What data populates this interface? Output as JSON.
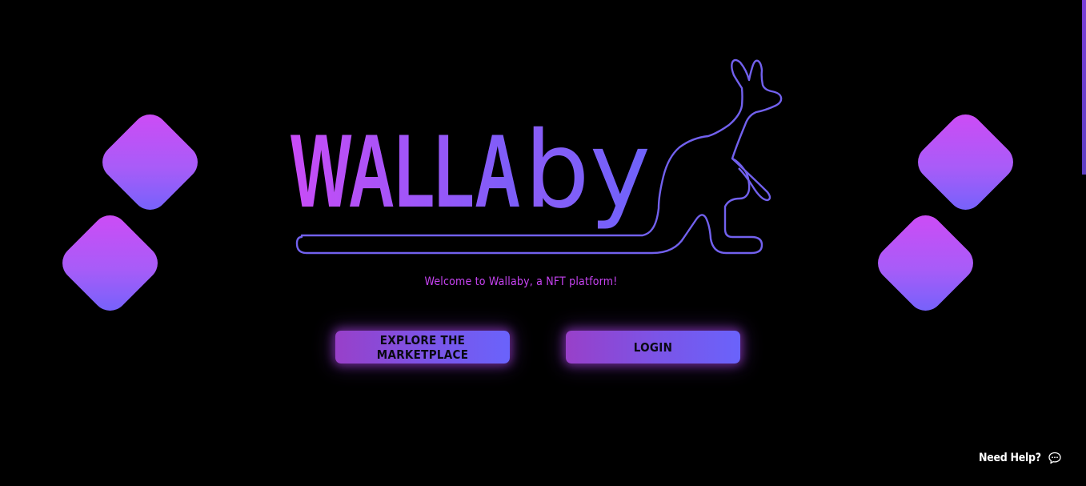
{
  "brand": {
    "name_upper": "WALLA",
    "name_lower": "by",
    "gradient_start": "#c94cf7",
    "gradient_end": "#6e63fb",
    "outline_color": "#7a63f0"
  },
  "hero": {
    "welcome_text": "Welcome to Wallaby, a NFT platform!"
  },
  "actions": {
    "explore_label": "Explore the Marketplace",
    "login_label": "LOGIN"
  },
  "help": {
    "label": "Need Help?",
    "icon": "chat-bubble-icon"
  },
  "colors": {
    "background": "#000000",
    "accent_pink": "#d14af5",
    "accent_violet": "#6e63fb",
    "welcome_text": "#c743f2"
  }
}
